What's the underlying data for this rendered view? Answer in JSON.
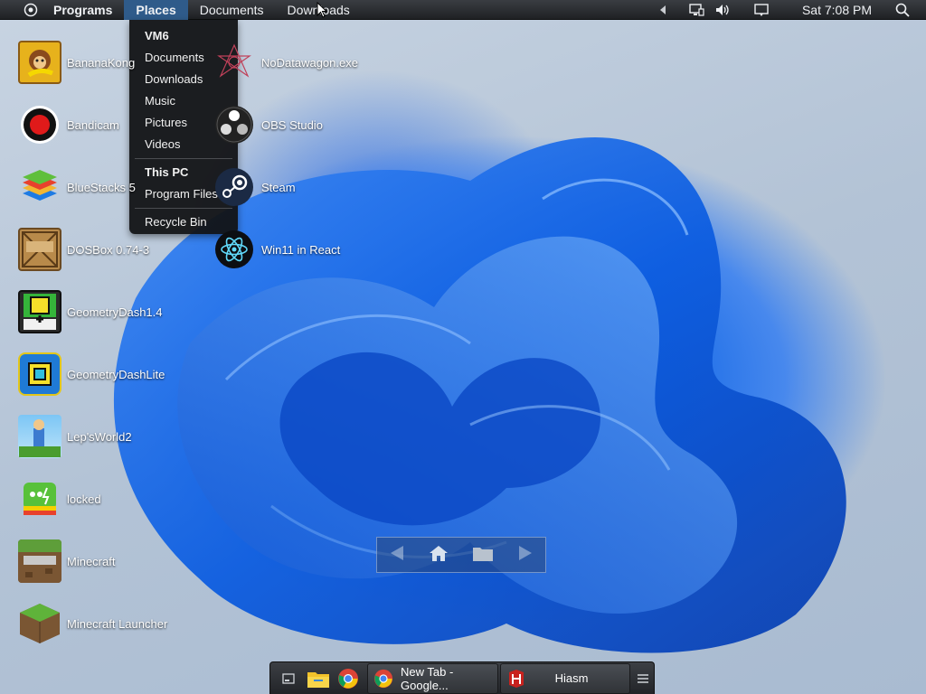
{
  "topbar": {
    "menus": [
      "Programs",
      "Places",
      "Documents",
      "Downloads"
    ],
    "active_menu": "Places",
    "clock": "Sat 7:08 PM",
    "icons": [
      "start-circle-icon",
      "tray-arrow-icon",
      "network-icon",
      "volume-icon",
      "notification-icon",
      "search-icon"
    ]
  },
  "places_menu": {
    "section1": [
      "VM6",
      "Documents",
      "Downloads",
      "Music",
      "Pictures",
      "Videos"
    ],
    "section2": [
      "This PC",
      "Program Files"
    ],
    "section3": [
      "Recycle Bin"
    ]
  },
  "desktop": {
    "column1": [
      "BananaKong",
      "Bandicam",
      "BlueStacks 5",
      "DOSBox 0.74-3",
      "GeometryDash1.4",
      "GeometryDashLite",
      "Lep'sWorld2",
      "locked",
      "Minecraft",
      "Minecraft Launcher"
    ],
    "column2": [
      "NoDatawagon.exe",
      "OBS Studio",
      "Steam",
      "Win11 in React"
    ]
  },
  "nav_widget": {
    "icons": [
      "back-arrow-icon",
      "home-icon",
      "folder-icon",
      "forward-arrow-icon"
    ]
  },
  "taskbar": {
    "quick_launch": [
      "show-desktop-icon",
      "file-explorer-icon",
      "chrome-icon"
    ],
    "tasks": [
      {
        "label": "New Tab - Google...",
        "icon": "chrome-icon"
      },
      {
        "label": "Hiasm",
        "icon": "hiasm-icon"
      }
    ],
    "menu_icon": "hamburger-menu-icon"
  },
  "colors": {
    "topbar": "#26282c",
    "menu_active": "#2f5b8a",
    "dropdown_bg": "#121315",
    "wallpaper_blue": "#1f6fe8"
  }
}
